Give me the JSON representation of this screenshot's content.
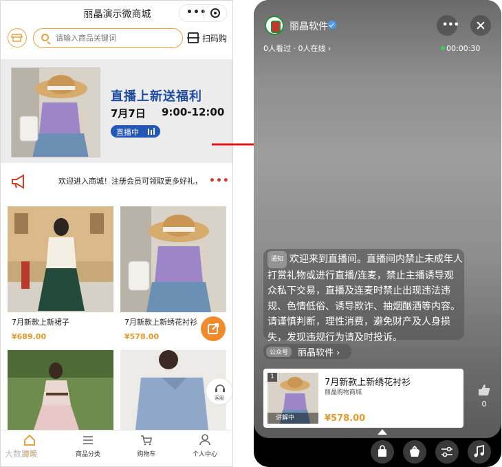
{
  "mall": {
    "title": "丽晶演示微商城",
    "search_placeholder": "请输入商品关键词",
    "scan_label": "扫码购",
    "banner": {
      "headline": "直播上新送福利",
      "date": "7月7日",
      "time": "9:00-12:00",
      "live_badge": "直播中"
    },
    "notice_text": "欢迎进入商城！注册会员可领取更多好礼，",
    "products": [
      {
        "name": "7月新款上新裙子",
        "price": "¥689.00"
      },
      {
        "name": "7月新款上新绣花衬衫",
        "price": "¥578.00"
      },
      {
        "name": "",
        "price": ""
      },
      {
        "name": "",
        "price": ""
      }
    ],
    "customer_service_label": "客服",
    "tabs": [
      {
        "label": "首页",
        "icon": "home-icon"
      },
      {
        "label": "商品分类",
        "icon": "menu-icon"
      },
      {
        "label": "购物车",
        "icon": "cart-icon"
      },
      {
        "label": "个人中心",
        "icon": "user-icon"
      }
    ],
    "watermark": "大数跨境"
  },
  "live": {
    "anchor_name": "丽晶软件",
    "viewers": "0人看过 · 0人在线 ›",
    "timer": "00:00:30",
    "notice_tag": "通知",
    "notice_text": "欢迎来到直播间。直播间内禁止未成年人打赏礼物或进行直播/连麦，禁止主播诱导观众私下交易，直播及连麦时禁止出现违法违规、色情低俗、诱导欺诈、抽烟酗酒等内容。请谨慎判断，理性消费，避免财产及人身损失，发现违规行为请及时投诉。",
    "official_tag": "公众号",
    "official_name": "丽晶软件 ›",
    "product": {
      "index": "1",
      "explaining": "讲解中",
      "name": "7月新款上新绣花衬衫",
      "shop": "丽晶购物商城",
      "price": "¥578.00"
    },
    "like_count": "0",
    "bottom_buttons": [
      "shopping-bag-icon",
      "gift-icon",
      "settings-sliders-icon",
      "music-icon"
    ]
  },
  "colors": {
    "accent": "#e39a2a",
    "banner_blue": "#1f4aa0",
    "arrow": "#e01818"
  }
}
